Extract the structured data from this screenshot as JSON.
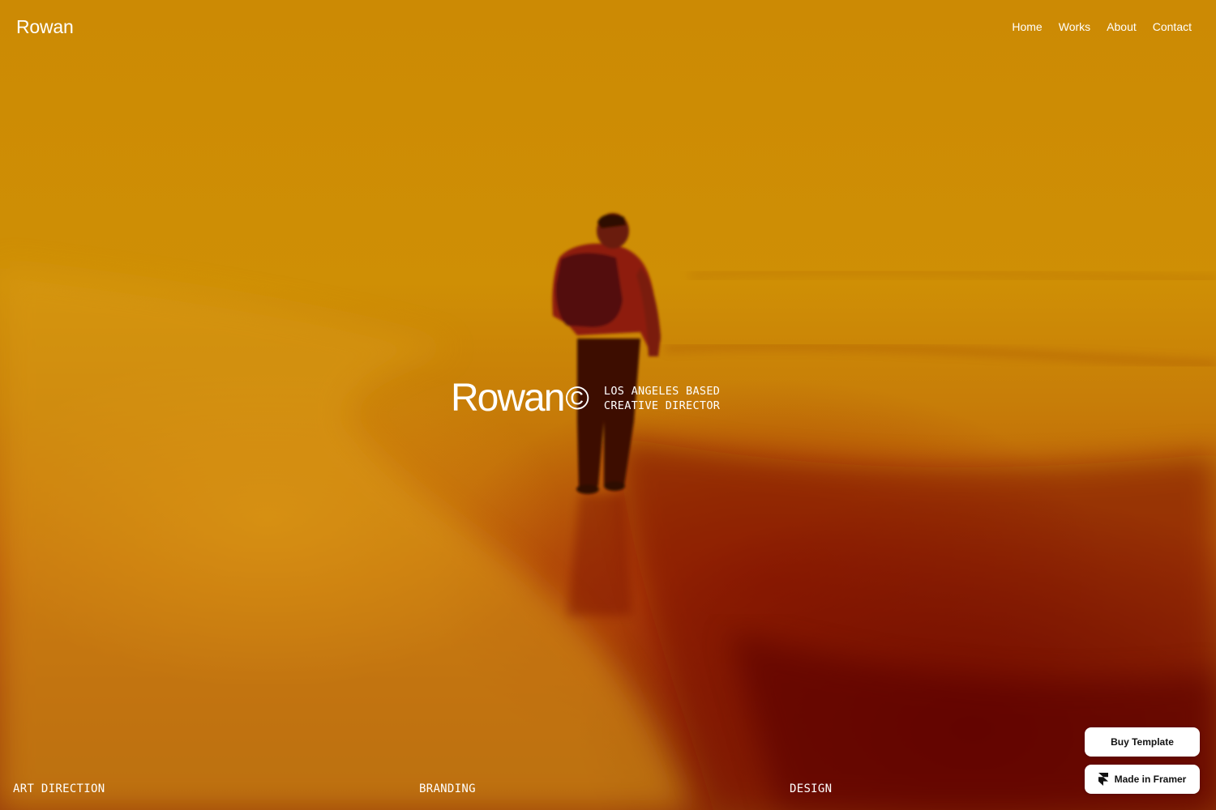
{
  "header": {
    "brand": "Rowan",
    "nav": [
      "Home",
      "Works",
      "About",
      "Contact"
    ]
  },
  "hero": {
    "name": "Rowan",
    "copyright_symbol": "©",
    "tagline_line1": "LOS ANGELES BASED",
    "tagline_line2": "CREATIVE DIRECTOR",
    "image_description_icon": "person-walking-on-beach-image"
  },
  "services": [
    "ART DIRECTION",
    "BRANDING",
    "DESIGN"
  ],
  "badges": {
    "buy_template": "Buy Template",
    "made_in_framer": "Made in Framer"
  },
  "colors": {
    "background_top": "#cc8a04",
    "background_bottom": "#9a3e08",
    "text": "#ffffff",
    "badge_bg": "#ffffff",
    "badge_text": "#111111"
  }
}
